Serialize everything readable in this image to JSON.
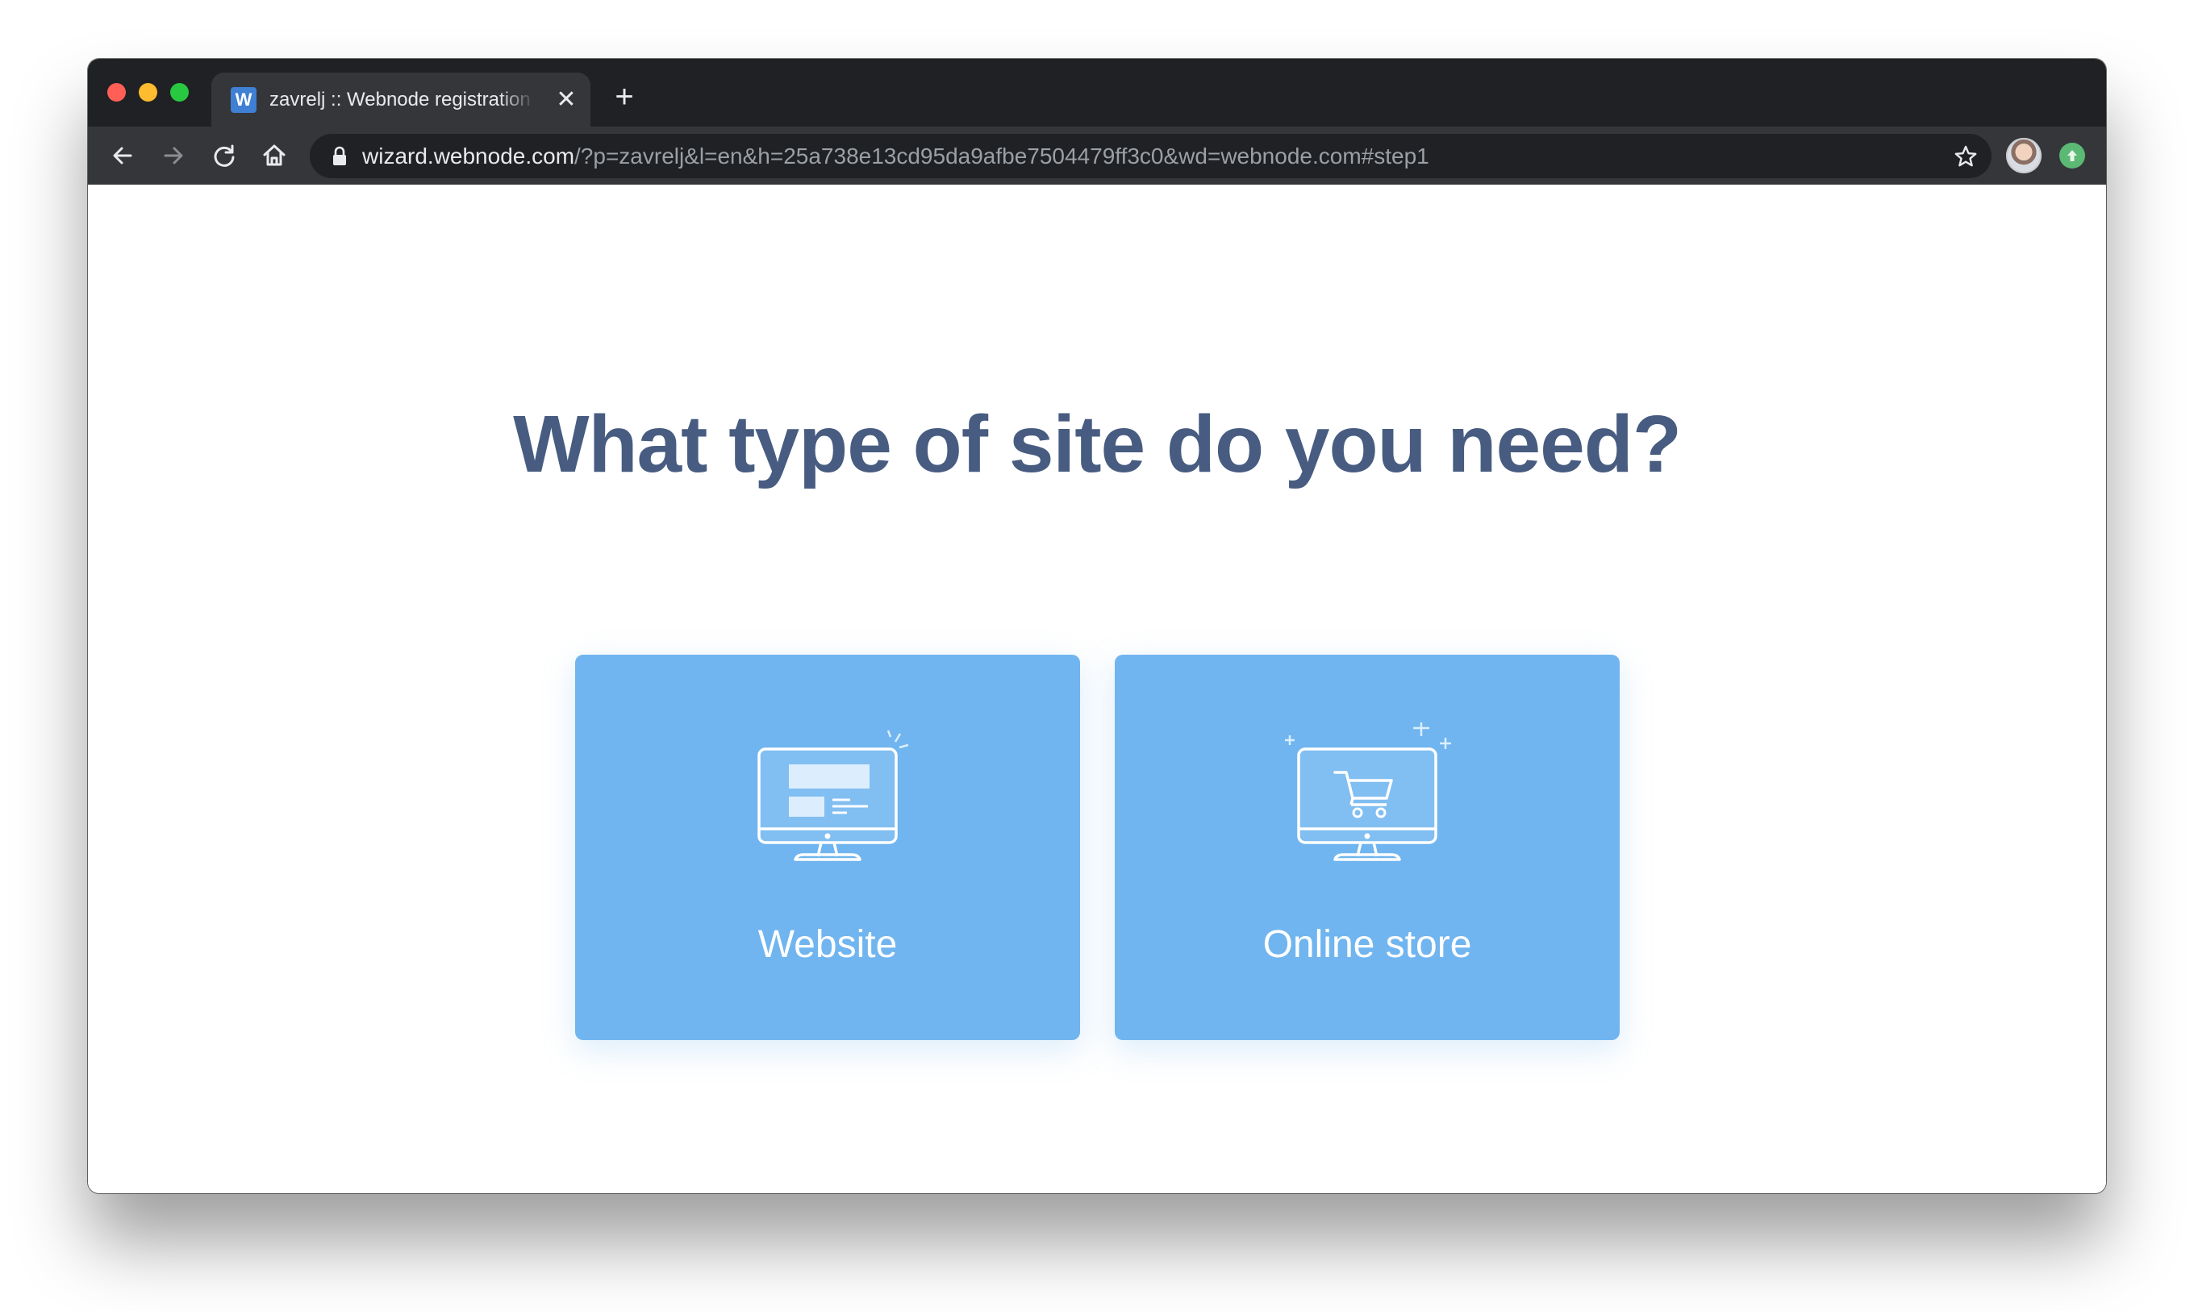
{
  "browser": {
    "tab": {
      "favicon_letter": "W",
      "title": "zavrelj :: Webnode registration wizard",
      "close_glyph": "✕"
    },
    "new_tab_glyph": "+",
    "address": {
      "host": "wizard.webnode.com",
      "rest": "/?p=zavrelj&l=en&h=25a738e13cd95da9afbe7504479ff3c0&wd=webnode.com#step1"
    },
    "colors": {
      "chrome_dark": "#202124",
      "chrome_toolbar": "#35363a"
    }
  },
  "page": {
    "heading": "What type of site do you need?",
    "options": [
      {
        "label": "Website",
        "icon": "monitor-website-icon"
      },
      {
        "label": "Online store",
        "icon": "monitor-cart-icon"
      }
    ],
    "colors": {
      "heading": "#475c80",
      "card": "#70b5ef"
    }
  }
}
